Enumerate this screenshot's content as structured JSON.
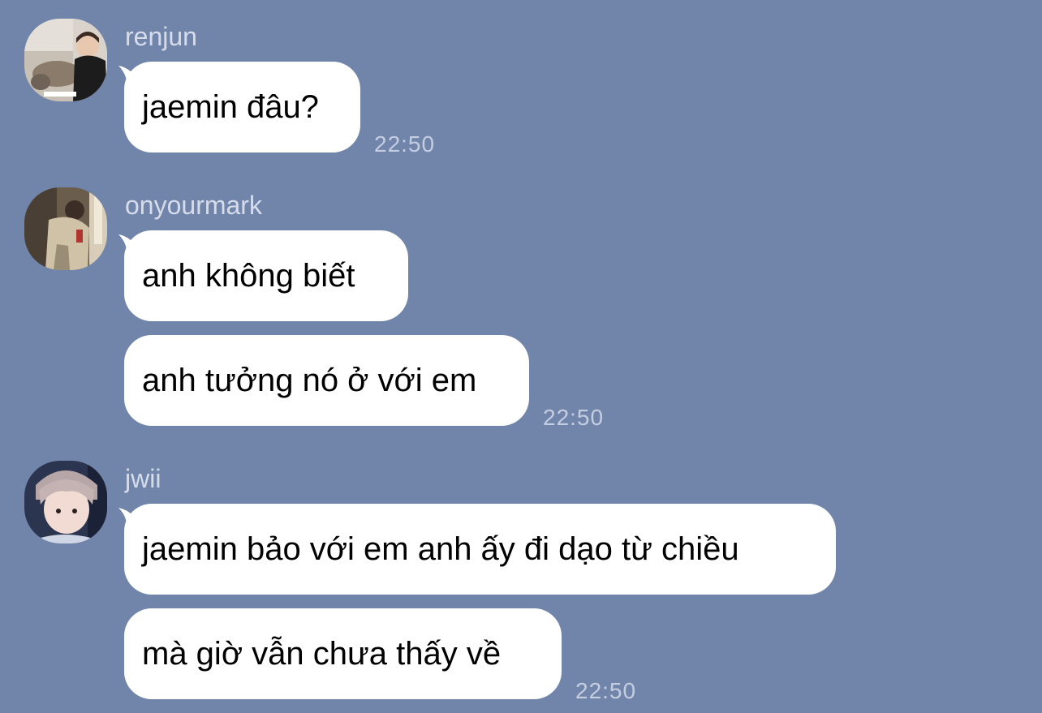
{
  "messages": [
    {
      "sender": "renjun",
      "avatar_icon": "avatar-photo-icon",
      "bubbles": [
        "jaemin đâu?"
      ],
      "time": "22:50"
    },
    {
      "sender": "onyourmark",
      "avatar_icon": "avatar-photo-icon",
      "bubbles": [
        "anh không biết",
        "anh tưởng nó ở với em"
      ],
      "time": "22:50"
    },
    {
      "sender": "jwii",
      "avatar_icon": "avatar-photo-icon",
      "bubbles": [
        "jaemin bảo với em anh ấy đi dạo từ chiều",
        "mà giờ vẫn chưa thấy về"
      ],
      "time": "22:50"
    }
  ],
  "colors": {
    "background": "#7185ab",
    "bubble": "#ffffff",
    "sender_text": "#d6dcea",
    "time_text": "#c5cde0"
  }
}
